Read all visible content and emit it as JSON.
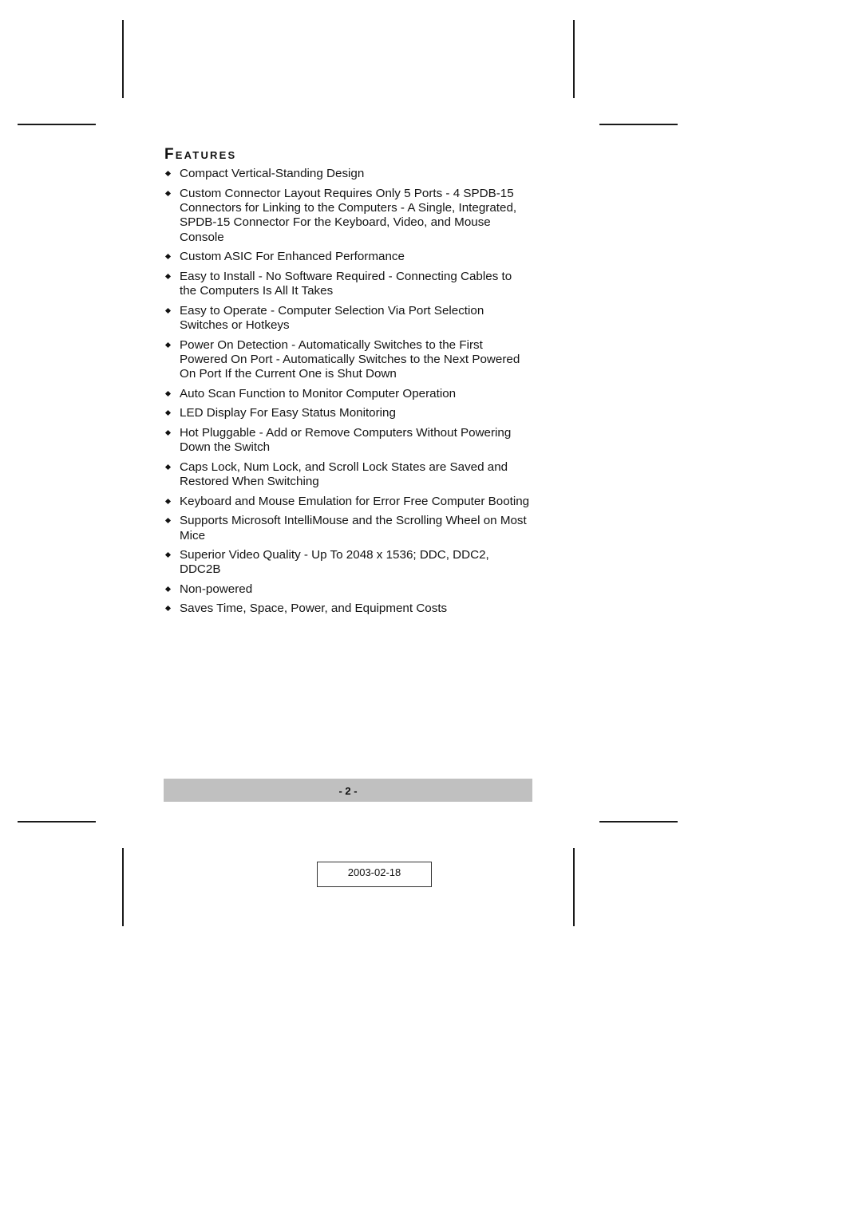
{
  "section": {
    "heading": "Features",
    "items": [
      {
        "text": "Compact Vertical-Standing Design"
      },
      {
        "text": "Custom Connector Layout Requires Only 5 Ports - 4 SPDB-15 Connectors for Linking to the Computers - A Single, Integrated, SPDB-15 Connector For the Keyboard, Video, and Mouse Console"
      },
      {
        "text": "Custom ASIC For Enhanced Performance"
      },
      {
        "text": "Easy to Install - No Software Required - Connecting Cables to the Computers Is All It Takes"
      },
      {
        "text": "Easy to Operate - Computer Selection Via Port Selection Switches or Hotkeys"
      },
      {
        "text": "Power On Detection - Automatically Switches to the First Powered On Port - Automatically Switches to the Next Powered On Port If the Current One is Shut Down"
      },
      {
        "text": "Auto Scan Function to Monitor Computer Operation"
      },
      {
        "text": "LED Display For Easy Status Monitoring"
      },
      {
        "text": "Hot Pluggable - Add or Remove Computers Without Powering Down the Switch"
      },
      {
        "text": "Caps Lock, Num Lock, and Scroll Lock States are Saved and Restored When Switching"
      },
      {
        "text": "Keyboard and Mouse Emulation for Error Free Computer Booting"
      },
      {
        "text": "Supports Microsoft IntelliMouse and the Scrolling Wheel on Most Mice"
      },
      {
        "text": "Superior Video Quality - Up To 2048 x 1536; DDC, DDC2, DDC2B"
      },
      {
        "text": "Non-powered"
      },
      {
        "text": "Saves Time, Space, Power, and Equipment Costs"
      }
    ]
  },
  "footer": {
    "page_number": "- 2 -",
    "date": "2003-02-18"
  },
  "colors": {
    "footer_bar": "#c0c0c0",
    "text": "#111111"
  }
}
